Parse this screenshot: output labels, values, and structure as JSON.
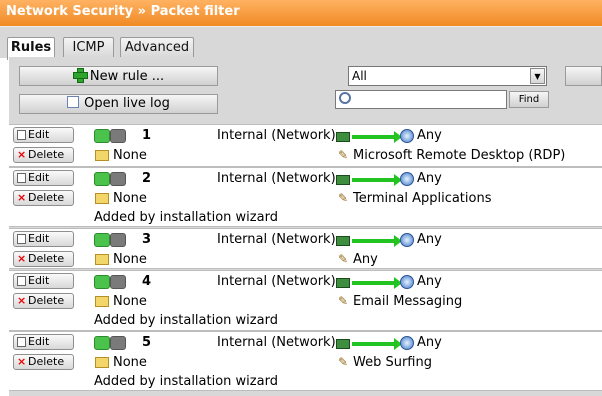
{
  "header": {
    "title": "Network Security » Packet filter"
  },
  "tabs": [
    {
      "label": "Rules",
      "active": true
    },
    {
      "label": "ICMP",
      "active": false
    },
    {
      "label": "Advanced",
      "active": false
    }
  ],
  "toolbar": {
    "new_rule_label": "New rule ...",
    "live_log_label": "Open live log",
    "filter_selected": "All",
    "search_value": "",
    "find_label": "Find"
  },
  "rules": [
    {
      "number": "1",
      "edit": "Edit",
      "delete": "Delete",
      "group": "None",
      "source": "Internal (Network)",
      "destination": "Any",
      "service": "Microsoft Remote Desktop (RDP)",
      "note": ""
    },
    {
      "number": "2",
      "edit": "Edit",
      "delete": "Delete",
      "group": "None",
      "source": "Internal (Network)",
      "destination": "Any",
      "service": "Terminal Applications",
      "note": "Added by installation wizard"
    },
    {
      "number": "3",
      "edit": "Edit",
      "delete": "Delete",
      "group": "None",
      "source": "Internal (Network)",
      "destination": "Any",
      "service": "Any",
      "note": ""
    },
    {
      "number": "4",
      "edit": "Edit",
      "delete": "Delete",
      "group": "None",
      "source": "Internal (Network)",
      "destination": "Any",
      "service": "Email Messaging",
      "note": "Added by installation wizard"
    },
    {
      "number": "5",
      "edit": "Edit",
      "delete": "Delete",
      "group": "None",
      "source": "Internal (Network)",
      "destination": "Any",
      "service": "Web Surfing",
      "note": "Added by installation wizard"
    }
  ],
  "colors": {
    "header": "#f08a24",
    "panel": "#d8d8d8",
    "enabled": "#4bc24b",
    "arrow": "#22c422"
  },
  "icons": [
    "plus-icon",
    "monitor-icon",
    "search-icon",
    "edit-icon",
    "delete-icon",
    "toggle-icon",
    "folder-icon",
    "network-card-icon",
    "arrow-icon",
    "globe-icon",
    "service-icon"
  ]
}
